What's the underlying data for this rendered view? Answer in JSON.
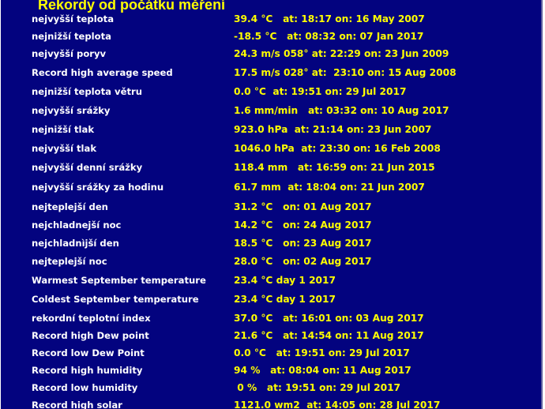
{
  "page": {
    "title": "Rekordy od počátku měření"
  },
  "colors": {
    "background": "#03037f",
    "label": "#ffffff",
    "value": "#ffff00",
    "title": "#ffff00"
  },
  "records": [
    {
      "label": "nejvyšší teplota",
      "value": "39.4 °C   at: 18:17 on: 16 May 2007"
    },
    {
      "label": "nejnižší teplota",
      "value": "-18.5 °C   at: 08:32 on: 07 Jan 2017"
    },
    {
      "label": "nejvyšší poryv",
      "value": "24.3 m/s 058° at: 22:29 on: 23 Jun 2009"
    },
    {
      "label": "Record high average speed",
      "value": "17.5 m/s 028° at:  23:10 on: 15 Aug 2008"
    },
    {
      "label": "nejnižší teplota větru",
      "value": "0.0 °C  at: 19:51 on: 29 Jul 2017"
    },
    {
      "label": "nejvyšší srážky",
      "value": "1.6 mm/min   at: 03:32 on: 10 Aug 2017"
    },
    {
      "label": "nejnižší tlak",
      "value": "923.0 hPa  at: 21:14 on: 23 Jun 2007"
    },
    {
      "label": "nejvyšší tlak",
      "value": "1046.0 hPa  at: 23:30 on: 16 Feb 2008"
    },
    {
      "label": "nejvyšší denní srážky",
      "value": "118.4 mm   at: 16:59 on: 21 Jun 2015"
    },
    {
      "label": "nejvyšší srážky za hodinu",
      "value": "61.7 mm  at: 18:04 on: 21 Jun 2007"
    },
    {
      "label": "nejteplejší den",
      "value": "31.2 °C   on: 01 Aug 2017"
    },
    {
      "label": "nejchladnejší noc",
      "value": "14.2 °C   on: 24 Aug 2017"
    },
    {
      "label": "nejchladnìjší den",
      "value": "18.5 °C   on: 23 Aug 2017"
    },
    {
      "label": "nejteplejší noc",
      "value": "28.0 °C   on: 02 Aug 2017"
    },
    {
      "label": "Warmest September temperature",
      "value": "23.4 °C day 1 2017"
    },
    {
      "label": "Coldest September temperature",
      "value": "23.4 °C day 1 2017"
    },
    {
      "label": "rekordní teplotní index",
      "value": "37.0 °C   at: 16:01 on: 03 Aug 2017"
    },
    {
      "label": "Record high Dew point",
      "value": "21.6 °C   at: 14:54 on: 11 Aug 2017"
    },
    {
      "label": "Record low Dew Point",
      "value": "0.0 °C   at: 19:51 on: 29 Jul 2017"
    },
    {
      "label": "Record high humidity",
      "value": "94 %   at: 08:04 on: 11 Aug 2017"
    },
    {
      "label": "Record low humidity",
      "value": " 0 %   at: 19:51 on: 29 Jul 2017"
    },
    {
      "label": "Record high solar",
      "value": "1121.0 wm2  at: 14:05 on: 28 Jul 2017"
    }
  ]
}
